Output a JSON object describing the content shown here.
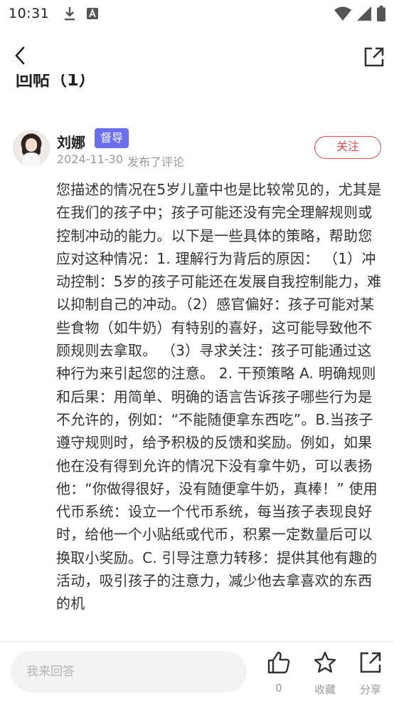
{
  "status_bar": {
    "time": "10:31"
  },
  "section": {
    "heading": "回帖（1）"
  },
  "comment": {
    "user_name": "刘娜",
    "role_badge": "督导",
    "date": "2024-11-30",
    "action_text": "发布了评论",
    "follow_label": "关注",
    "body": "您描述的情况在5岁儿童中也是比较常见的，尤其是在我们的孩子中；孩子可能还没有完全理解规则或控制冲动的能力。以下是一些具体的策略，帮助您应对这种情况：1. 理解行为背后的原因： （1）冲动控制：5岁的孩子可能还在发展自我控制能力，难以抑制自己的冲动。（2）感官偏好：孩子可能对某些食物（如牛奶）有特别的喜好，这可能导致他不顾规则去拿取。 （3）寻求关注：孩子可能通过这种行为来引起您的注意。 2. 干预策略 A. 明确规则和后果：用简单、明确的语言告诉孩子哪些行为是不允许的，例如：“不能随便拿东西吃”。B.当孩子遵守规则时，给予积极的反馈和奖励。例如，如果他在没有得到允许的情况下没有拿牛奶，可以表扬他：“你做得很好，没有随便拿牛奶，真棒！” 使用代币系统：设立一个代币系统，每当孩子表现良好时，给他一个小贴纸或代币，积累一定数量后可以换取小奖励。C. 引导注意力转移：提供其他有趣的活动，吸引孩子的注意力，减少他去拿喜欢的东西的机"
  },
  "bottom_bar": {
    "reply_placeholder": "我来回答",
    "like_count": "0",
    "favorite_label": "收藏",
    "share_label": "分享"
  },
  "colors": {
    "badge": "#6a6ff0",
    "follow": "#e84a4a",
    "muted_text": "#999999"
  },
  "icons": {
    "status_left": [
      "download-icon",
      "keyboard-a-icon"
    ],
    "status_right": [
      "wifi-icon",
      "cellular-signal-icon",
      "battery-icon"
    ],
    "nav": [
      "back-chevron-icon",
      "share-icon"
    ],
    "actions": [
      "thumbs-up-icon",
      "star-icon",
      "share-icon"
    ]
  }
}
